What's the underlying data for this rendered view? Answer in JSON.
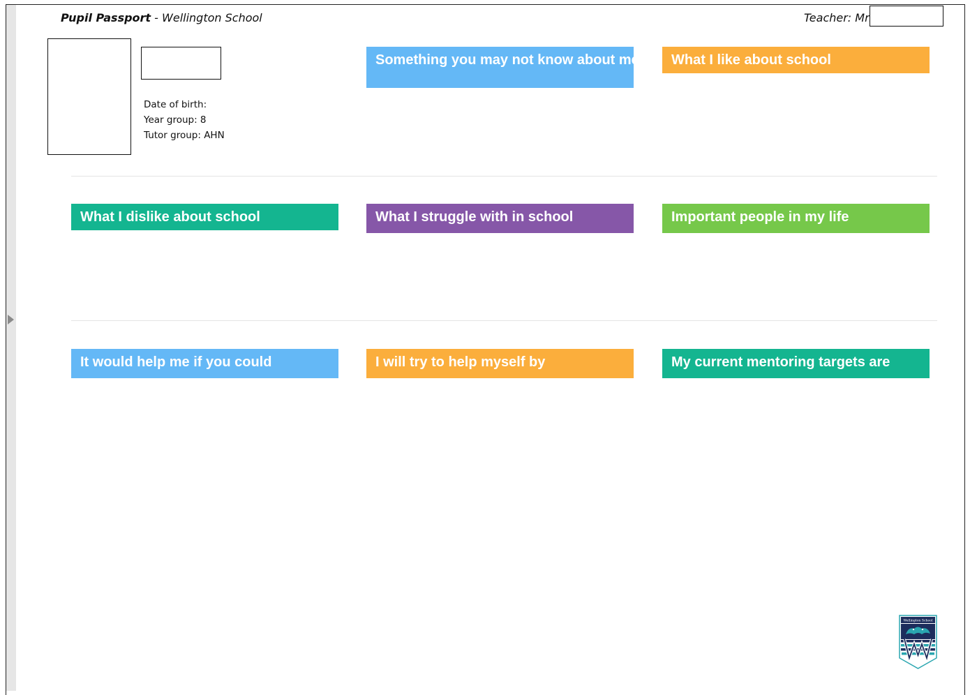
{
  "header": {
    "doc_title_bold": "Pupil Passport",
    "doc_title_rest": " - Wellington School",
    "teacher_label": "Teacher: Mrs"
  },
  "pupil": {
    "date_of_birth_label": "Date of birth:",
    "year_group": "Year group: 8",
    "tutor_group": "Tutor group: AHN"
  },
  "sections": [
    {
      "label": "Something you may not know about me",
      "color": "#64b8f6"
    },
    {
      "label": "What I like about school",
      "color": "#fbae3c"
    },
    {
      "label": "What I dislike about school",
      "color": "#14b590"
    },
    {
      "label": "What I struggle with in school",
      "color": "#8657a8"
    },
    {
      "label": "Important people in my life",
      "color": "#76c84a"
    },
    {
      "label": "It would help me if you could",
      "color": "#64b8f6"
    },
    {
      "label": "I will try to help myself by",
      "color": "#fbae3c"
    },
    {
      "label": "My current mentoring targets are",
      "color": "#14b590"
    }
  ],
  "crest": {
    "text": "Wellington School",
    "icon": "school-crest-icon",
    "colors": {
      "navy": "#1d2d5c",
      "teal": "#2aa6b0"
    }
  }
}
